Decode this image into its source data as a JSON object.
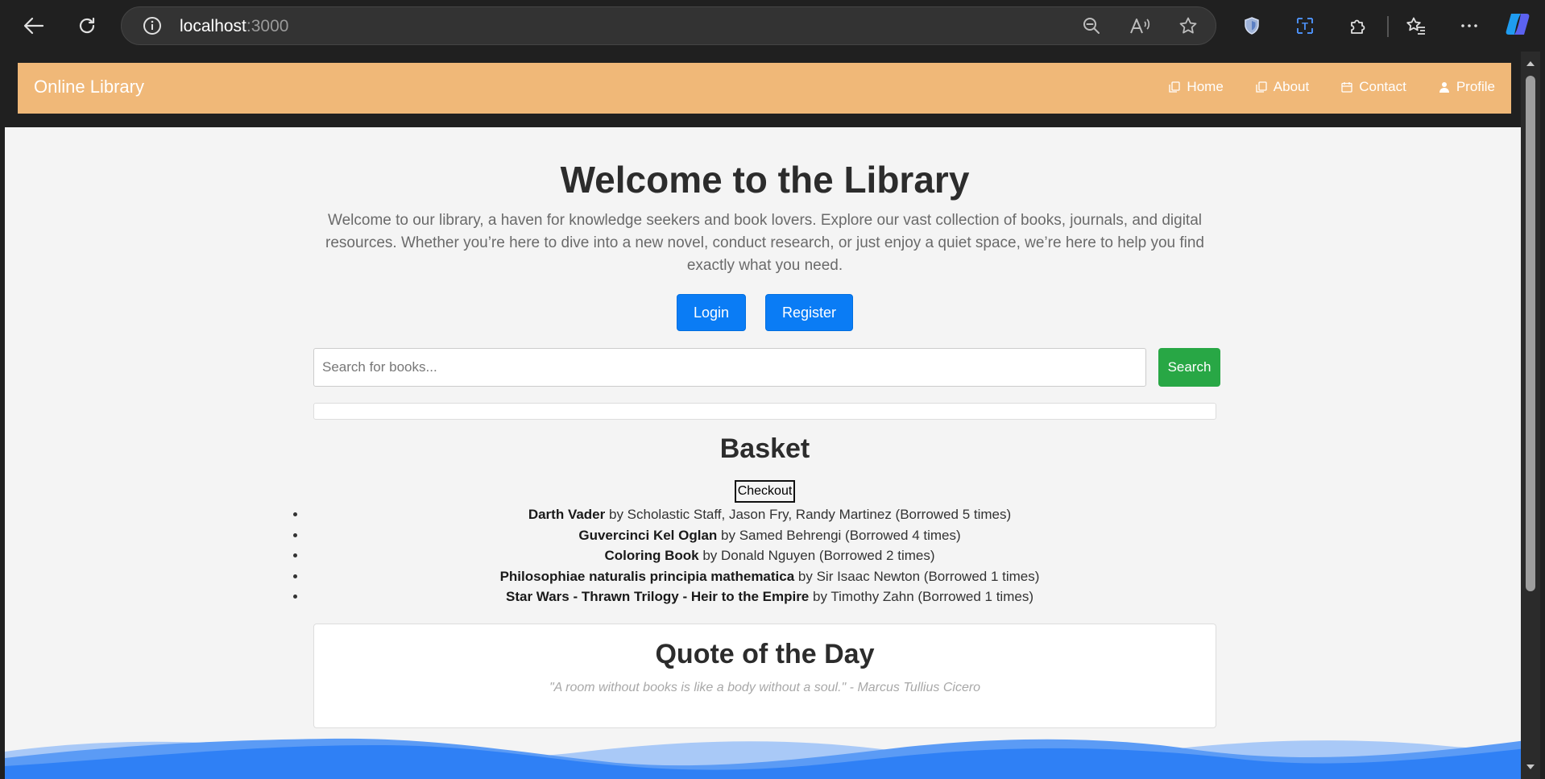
{
  "browser": {
    "url_host": "localhost",
    "url_port": ":3000"
  },
  "navbar": {
    "brand": "Online Library",
    "links": [
      {
        "label": "Home",
        "icon": "copy-icon"
      },
      {
        "label": "About",
        "icon": "copy-icon"
      },
      {
        "label": "Contact",
        "icon": "calendar-icon"
      },
      {
        "label": "Profile",
        "icon": "user-icon"
      }
    ]
  },
  "hero": {
    "title": "Welcome to the Library",
    "text": "Welcome to our library, a haven for knowledge seekers and book lovers. Explore our vast collection of books, journals, and digital resources. Whether you’re here to dive into a new novel, conduct research, or just enjoy a quiet space, we’re here to help you find exactly what you need.",
    "login_label": "Login",
    "register_label": "Register"
  },
  "search": {
    "placeholder": "Search for books...",
    "button_label": "Search"
  },
  "basket": {
    "title": "Basket",
    "checkout_label": "Checkout",
    "items": [
      {
        "title": "Darth Vader",
        "rest": " by Scholastic Staff, Jason Fry, Randy Martinez (Borrowed 5 times)"
      },
      {
        "title": "Guvercinci Kel Oglan",
        "rest": " by Samed Behrengi (Borrowed 4 times)"
      },
      {
        "title": "Coloring Book",
        "rest": " by Donald Nguyen (Borrowed 2 times)"
      },
      {
        "title": "Philosophiae naturalis principia mathematica",
        "rest": " by Sir Isaac Newton (Borrowed 1 times)"
      },
      {
        "title": "Star Wars - Thrawn Trilogy - Heir to the Empire",
        "rest": " by Timothy Zahn (Borrowed 1 times)"
      }
    ]
  },
  "quote": {
    "title": "Quote of the Day",
    "text": "\"A room without books is like a body without a soul.\" - Marcus Tullius Cicero"
  },
  "colors": {
    "navbar": "#f0b878",
    "primary_button": "#0a7cf5",
    "search_button": "#28a745",
    "wave": "#2f80f5"
  }
}
